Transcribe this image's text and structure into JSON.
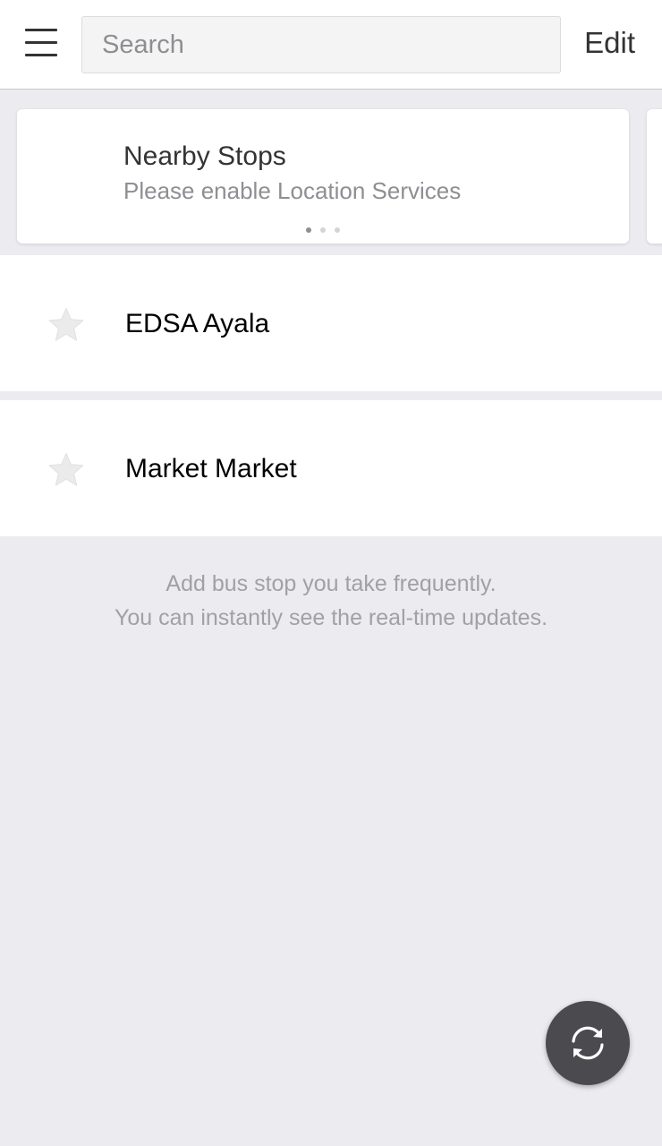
{
  "header": {
    "search_placeholder": "Search",
    "edit_label": "Edit"
  },
  "nearby_card": {
    "title": "Nearby Stops",
    "subtitle": "Please enable Location Services",
    "page_count": 3,
    "active_page": 1
  },
  "stops": [
    {
      "name": "EDSA Ayala",
      "favorited": false
    },
    {
      "name": "Market Market",
      "favorited": false
    }
  ],
  "hint": {
    "line1": "Add bus stop you take frequently.",
    "line2": "You can instantly see the real-time updates."
  },
  "icons": {
    "menu": "hamburger-menu-icon",
    "star": "star-icon",
    "refresh": "refresh-icon"
  },
  "colors": {
    "background": "#ebebf0",
    "card": "#ffffff",
    "fab": "#4a4a4f",
    "star": "#ebebeb",
    "muted_text": "#8e8e93"
  }
}
